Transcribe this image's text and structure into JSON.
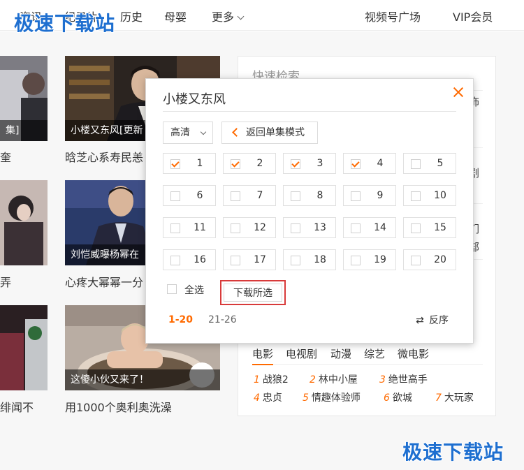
{
  "nav": {
    "items": [
      "资讯",
      "纪录片",
      "历史",
      "母婴"
    ],
    "more_label": "更多",
    "right_items": [
      "视频号广场",
      "VIP会员"
    ]
  },
  "watermark": {
    "text": "极速下载站"
  },
  "left_column": {
    "titles": [
      "奎",
      "弄",
      "绯闻不"
    ],
    "caption_fragment": "集]"
  },
  "middle_column": {
    "captions": [
      "小楼又东风[更新",
      "刘恺威曝杨幂在",
      "这傻小伙又来了！"
    ],
    "titles": [
      "晗芝心系寿民恙",
      "心疼大幂幂一分",
      "用1000个奥利奥洗澡"
    ]
  },
  "right_panel": {
    "heading": "快速检索",
    "fragments": [
      "饰",
      "剧",
      "们",
      "部"
    ],
    "tabs": [
      "电影",
      "电视剧",
      "动漫",
      "综艺",
      "微电影"
    ],
    "rank_items": [
      {
        "num": "1",
        "name": "战狼2"
      },
      {
        "num": "2",
        "name": "林中小屋"
      },
      {
        "num": "3",
        "name": "绝世高手"
      },
      {
        "num": "4",
        "name": "忠贞"
      },
      {
        "num": "5",
        "name": "情趣体验师"
      },
      {
        "num": "6",
        "name": "欲城"
      },
      {
        "num": "7",
        "name": "大玩家"
      }
    ]
  },
  "popup": {
    "title": "小楼又东风",
    "quality": "高清",
    "back_label": "返回单集模式",
    "episodes": [
      {
        "num": "1",
        "checked": true
      },
      {
        "num": "2",
        "checked": true
      },
      {
        "num": "3",
        "checked": true
      },
      {
        "num": "4",
        "checked": true
      },
      {
        "num": "5",
        "checked": false
      },
      {
        "num": "6",
        "checked": false
      },
      {
        "num": "7",
        "checked": false
      },
      {
        "num": "8",
        "checked": false
      },
      {
        "num": "9",
        "checked": false
      },
      {
        "num": "10",
        "checked": false
      },
      {
        "num": "11",
        "checked": false
      },
      {
        "num": "12",
        "checked": false
      },
      {
        "num": "13",
        "checked": false
      },
      {
        "num": "14",
        "checked": false
      },
      {
        "num": "15",
        "checked": false
      },
      {
        "num": "16",
        "checked": false
      },
      {
        "num": "17",
        "checked": false
      },
      {
        "num": "18",
        "checked": false
      },
      {
        "num": "19",
        "checked": false
      },
      {
        "num": "20",
        "checked": false
      }
    ],
    "select_all_label": "全选",
    "download_label": "下载所选",
    "page_ranges": [
      "1-20",
      "21-26"
    ],
    "reverse_label": "反序",
    "accent_color": "#ff6a00",
    "highlight_color": "#d83a3a"
  }
}
